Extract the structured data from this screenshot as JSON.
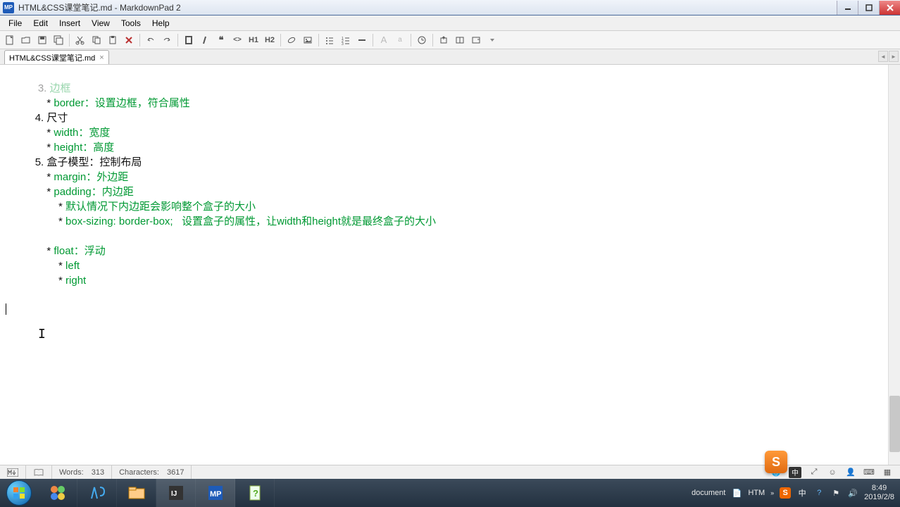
{
  "title": "HTML&CSS课堂笔记.md - MarkdownPad 2",
  "appicon_text": "MP",
  "menu": [
    "File",
    "Edit",
    "Insert",
    "View",
    "Tools",
    "Help"
  ],
  "tab": {
    "label": "HTML&CSS课堂笔记.md"
  },
  "toolbar": {
    "h1": "H1",
    "h2": "H2",
    "bigA": "A",
    "smallA": "a"
  },
  "doc": {
    "l1a": "3. ",
    "l1b": "边框",
    "l2a": "* ",
    "l2b": "border：设置边框，符合属性",
    "l3a": "4. ",
    "l3b": "尺寸",
    "l4a": "* ",
    "l4b": "width：宽度",
    "l5a": "* ",
    "l5b": "height：高度",
    "l6a": "5. ",
    "l6b": "盒子模型：控制布局",
    "l7a": "* ",
    "l7b": "margin：外边距",
    "l8a": "* ",
    "l8b": "padding：内边距",
    "l9a": "* ",
    "l9b": "默认情况下内边距会影响整个盒子的大小",
    "l10a": "* ",
    "l10b": "box-sizing: border-box;   设置盒子的属性，让width和height就是最终盒子的大小",
    "l11": "",
    "l12a": "* ",
    "l12b": "float：浮动",
    "l13a": "* ",
    "l13b": "left",
    "l14a": "* ",
    "l14b": "right"
  },
  "status": {
    "words_label": "Words:",
    "words_value": "313",
    "chars_label": "Characters:",
    "chars_value": "3617"
  },
  "tray": {
    "doc": "document",
    "htm": "HTM",
    "zhong": "中",
    "time": "8:49",
    "date": "2019/2/8"
  },
  "sogou": "S"
}
